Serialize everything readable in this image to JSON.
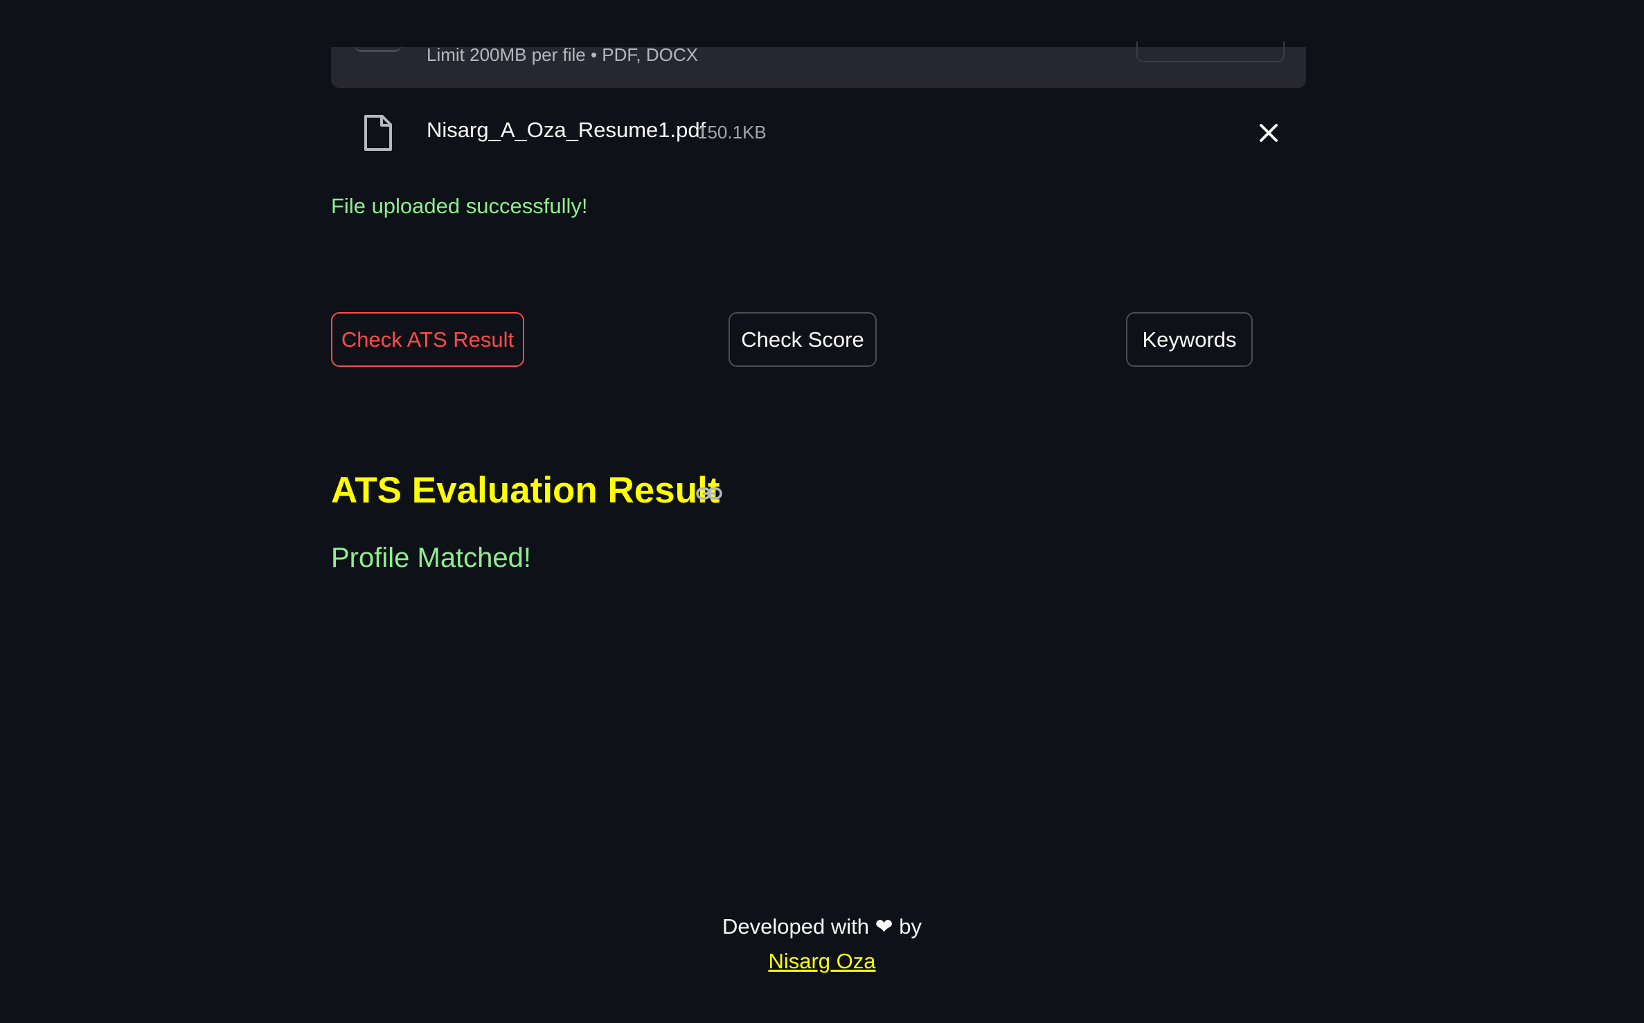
{
  "uploader": {
    "limit_text": "Limit 200MB per file • PDF, DOCX",
    "file_icon": "file-icon",
    "file_name": "Nisarg_A_Oza_Resume1.pdf",
    "file_size": "150.1KB",
    "remove_icon": "close-icon"
  },
  "status": {
    "success_message": "File uploaded successfully!"
  },
  "actions": {
    "check_ats_label": "Check ATS Result",
    "check_score_label": "Check Score",
    "keywords_label": "Keywords"
  },
  "result": {
    "heading": "ATS Evaluation Result",
    "anchor_icon": "link-icon",
    "message": "Profile Matched!"
  },
  "footer": {
    "developed_text": "Developed with ❤ by",
    "author_link": "Nisarg Oza"
  },
  "colors": {
    "background": "#0e1117",
    "accent_red": "#ff4b4b",
    "success_green": "#90ee90",
    "heading_yellow": "#ffff00"
  }
}
